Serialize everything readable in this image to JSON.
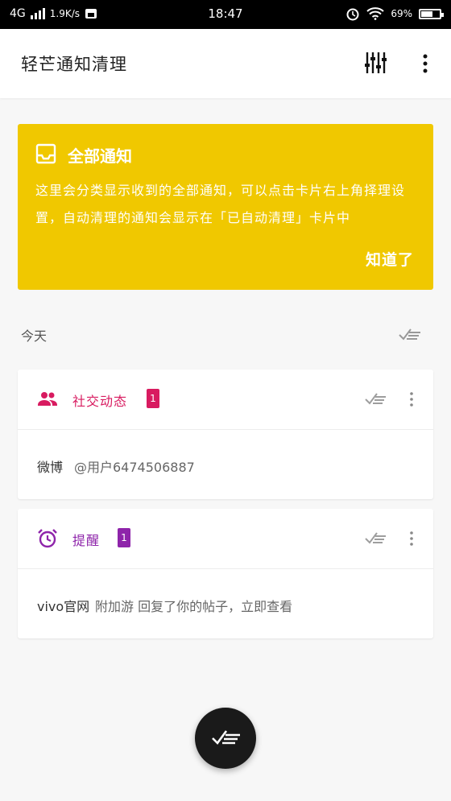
{
  "status_bar": {
    "network": "4G",
    "speed": "1.9K/s",
    "time": "18:47",
    "battery": "69%"
  },
  "app_bar": {
    "title": "轻芒通知清理"
  },
  "banner": {
    "title": "全部通知",
    "body": "这里会分类显示收到的全部通知，可以点击卡片右上角择理设置，自动清理的通知会显示在「已自动清理」卡片中",
    "ok_label": "知道了",
    "color": "#f0c800"
  },
  "section": {
    "label": "今天"
  },
  "cards": [
    {
      "label": "社交动态",
      "count": "1",
      "color": "#d81b60",
      "icon": "people-icon",
      "app": "微博",
      "message": "@用户6474506887"
    },
    {
      "label": "提醒",
      "count": "1",
      "color": "#8e24aa",
      "icon": "alarm-icon",
      "app": "vivo官网",
      "message": "附加游 回复了你的帖子，立即查看"
    }
  ]
}
